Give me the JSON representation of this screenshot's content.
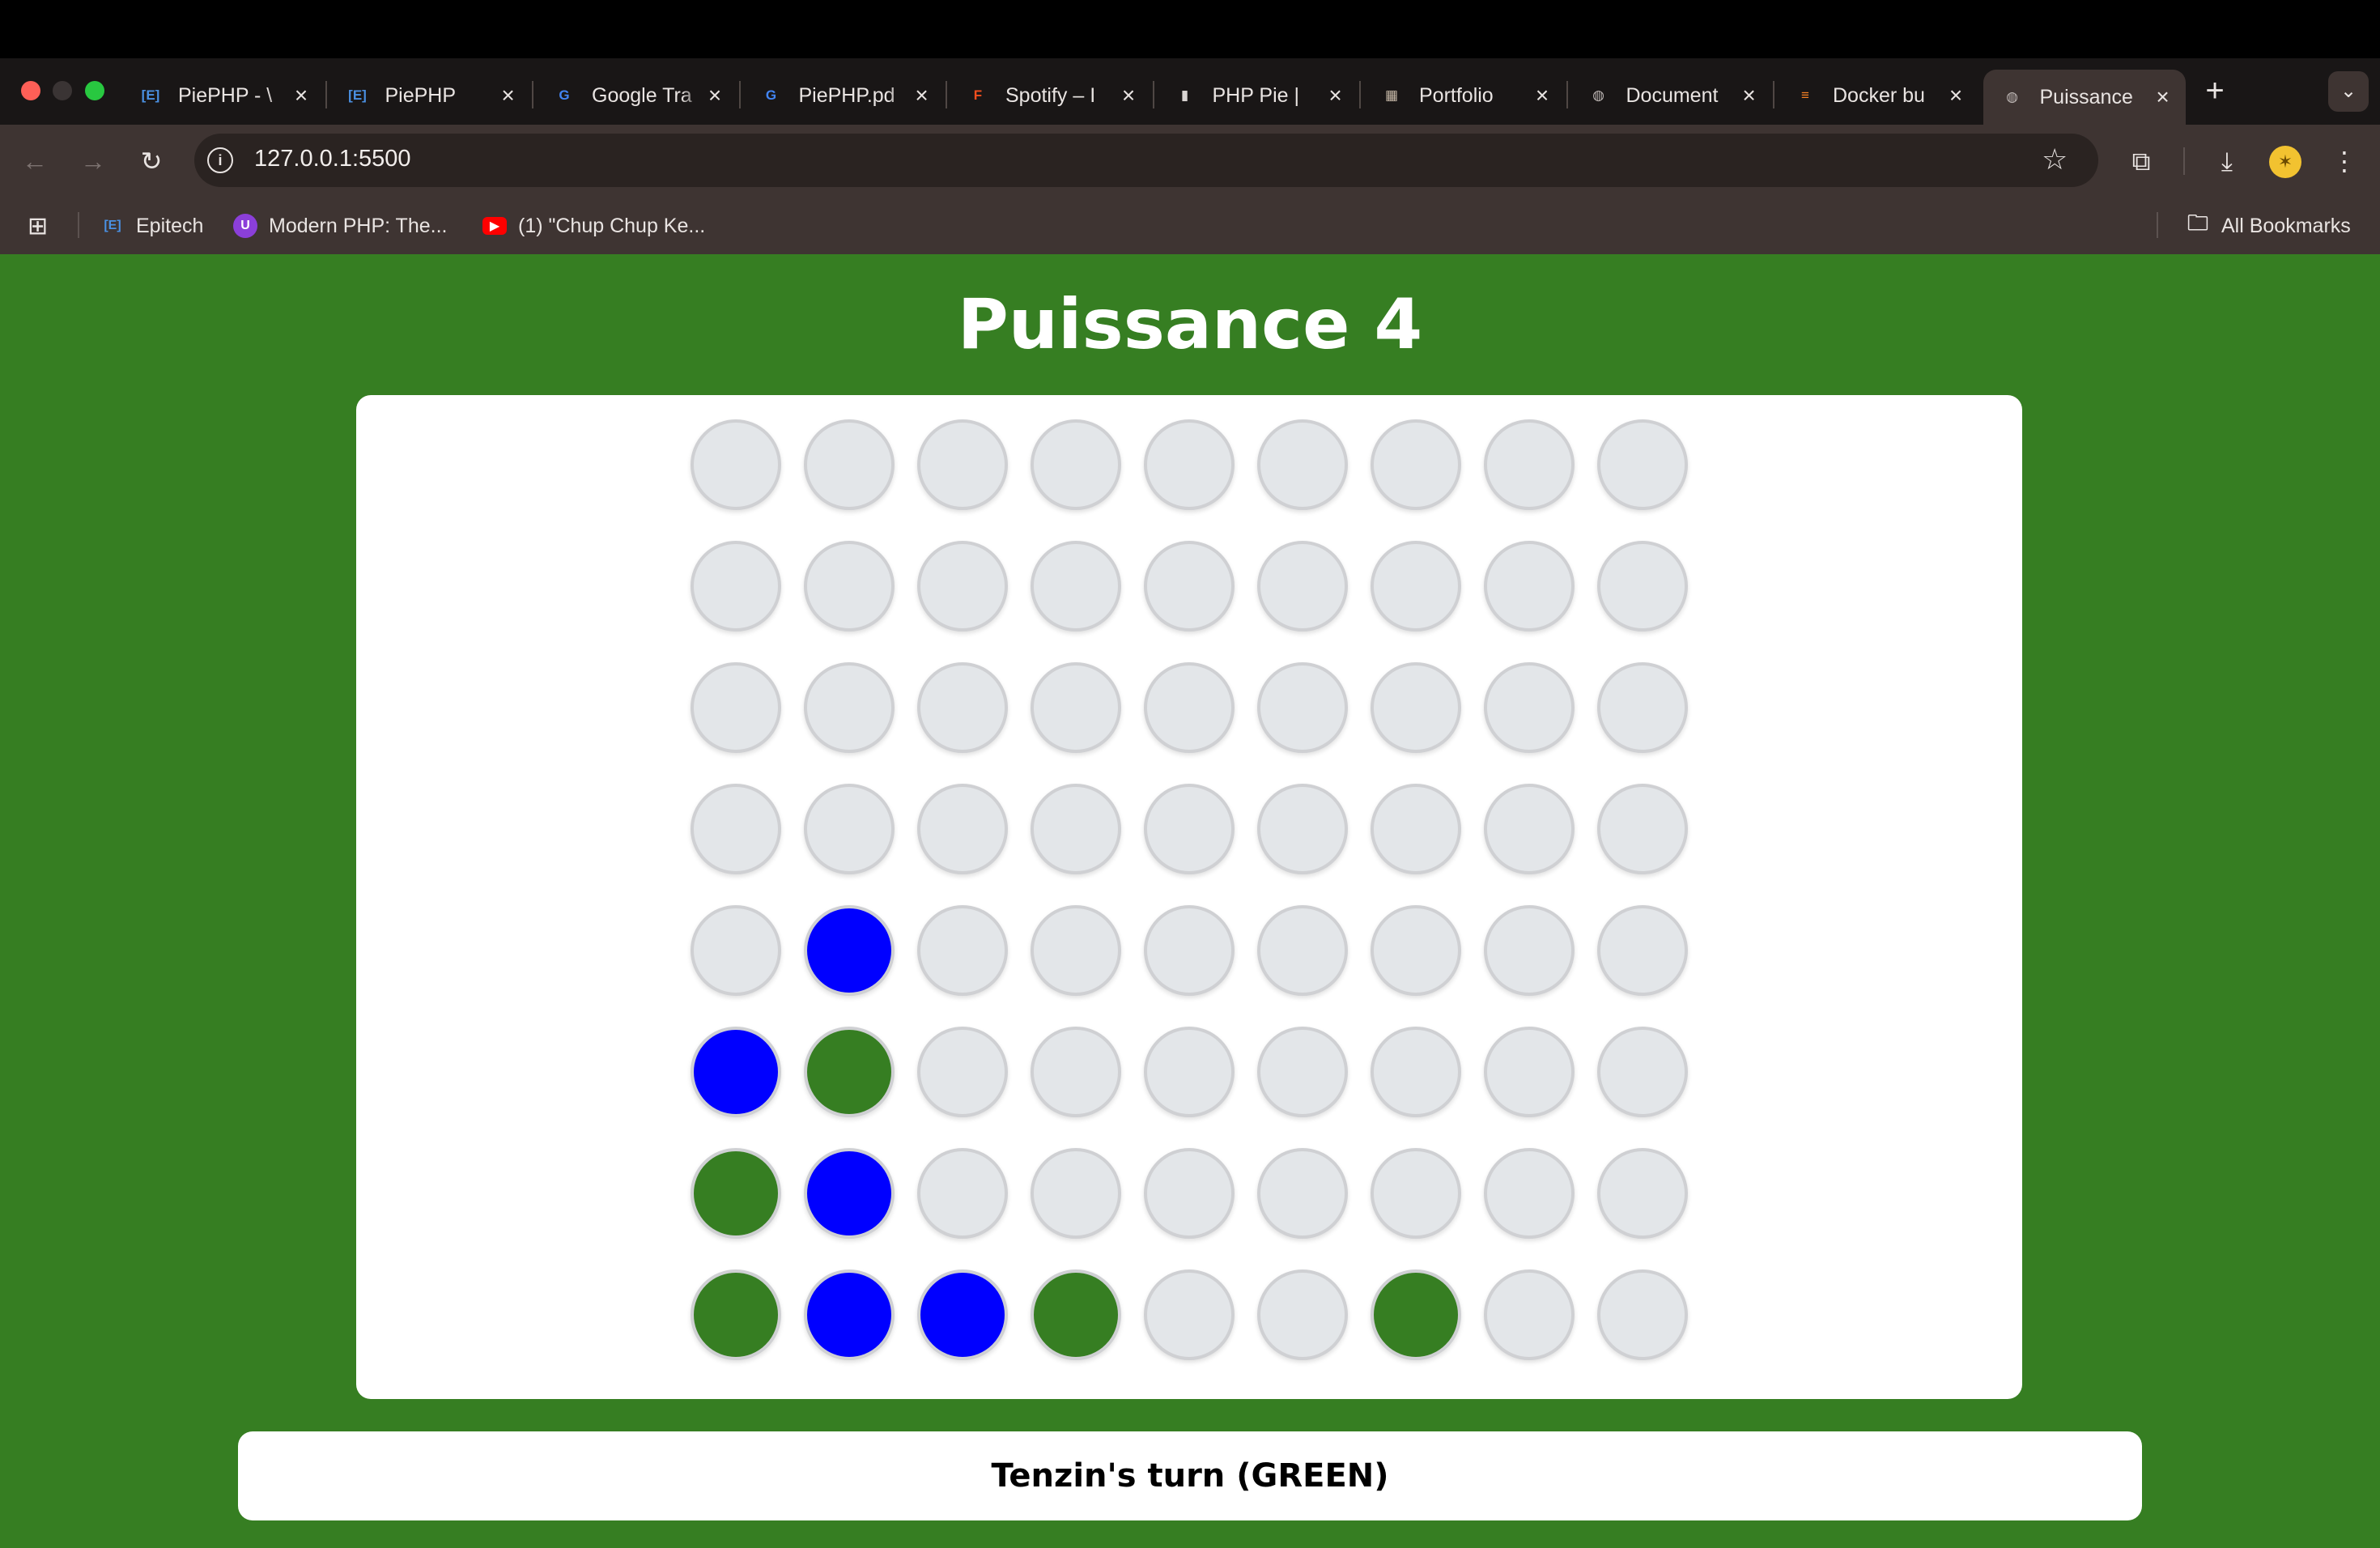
{
  "browser": {
    "tabs": [
      {
        "title": "PiePHP - \\",
        "icon": "epitech-favicon",
        "glyph": "[E]",
        "color": "#4a90e2"
      },
      {
        "title": "PiePHP",
        "icon": "epitech-favicon",
        "glyph": "[E]",
        "color": "#4a90e2"
      },
      {
        "title": "Google Tra",
        "icon": "google-translate-favicon",
        "glyph": "G",
        "color": "#4285f4"
      },
      {
        "title": "PiePHP.pd",
        "icon": "google-translate-favicon",
        "glyph": "G",
        "color": "#4285f4"
      },
      {
        "title": "Spotify – I",
        "icon": "figma-favicon",
        "glyph": "F",
        "color": "#f24e1e"
      },
      {
        "title": "PHP Pie |",
        "icon": "document-favicon",
        "glyph": "▮",
        "color": "#d9d4d2"
      },
      {
        "title": "Portfolio",
        "icon": "portfolio-favicon",
        "glyph": "▦",
        "color": "#c7b9a8"
      },
      {
        "title": "Document",
        "icon": "globe-favicon",
        "glyph": "◍",
        "color": "#bdb6b4"
      },
      {
        "title": "Docker bu",
        "icon": "stackoverflow-favicon",
        "glyph": "≡",
        "color": "#f48024"
      },
      {
        "title": "Puissance",
        "icon": "globe-favicon",
        "glyph": "◍",
        "color": "#bdb6b4",
        "active": true
      }
    ],
    "url": "127.0.0.1:5500",
    "bookmarks": {
      "epitech": "Epitech",
      "modern_php": "Modern PHP: The...",
      "youtube": "(1) \"Chup Chup Ke...",
      "all": "All Bookmarks"
    }
  },
  "game": {
    "title": "Puissance 4",
    "rows": 8,
    "cols": 9,
    "board": [
      [
        0,
        0,
        0,
        0,
        0,
        0,
        0,
        0,
        0
      ],
      [
        0,
        0,
        0,
        0,
        0,
        0,
        0,
        0,
        0
      ],
      [
        0,
        0,
        0,
        0,
        0,
        0,
        0,
        0,
        0
      ],
      [
        0,
        0,
        0,
        0,
        0,
        0,
        0,
        0,
        0
      ],
      [
        0,
        2,
        0,
        0,
        0,
        0,
        0,
        0,
        0
      ],
      [
        2,
        1,
        0,
        0,
        0,
        0,
        0,
        0,
        0
      ],
      [
        1,
        2,
        0,
        0,
        0,
        0,
        0,
        0,
        0
      ],
      [
        1,
        2,
        2,
        1,
        0,
        0,
        1,
        0,
        0
      ]
    ],
    "legend": {
      "0": "empty",
      "1": "green",
      "2": "blue"
    },
    "colors": {
      "background": "#367e22",
      "green": "#367e22",
      "blue": "#0000ff",
      "empty": "#e3e6e9"
    },
    "status": "Tenzin's turn (GREEN)"
  }
}
